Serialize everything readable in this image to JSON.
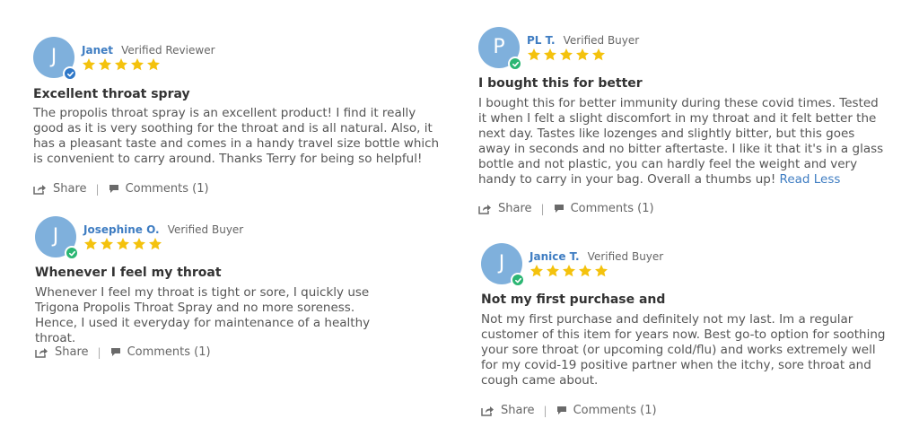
{
  "colors": {
    "avatar": "#7fb0dc",
    "name": "#3f7dc2",
    "star": "#f4c20d",
    "badge_blue": "#2f78c8",
    "badge_green": "#2bb673"
  },
  "icons": {
    "share": "share-arrow-icon",
    "comments": "comment-bubble-icon",
    "star": "star-icon",
    "verified": "check-badge-icon"
  },
  "reviews": [
    {
      "initial": "J",
      "name": "Janet",
      "status": "Verified Reviewer",
      "rating": 5,
      "title": "Excellent throat spray",
      "body": "The propolis throat spray is an excellent product! I find it really good as it is very soothing for the throat and is all natural. Also, it has a pleasant taste and comes in a handy travel size bottle which is convenient to carry around. Thanks Terry for being so helpful!",
      "share": "Share",
      "comments": "Comments (1)"
    },
    {
      "initial": "J",
      "name": "Josephine O.",
      "status": "Verified Buyer",
      "rating": 5,
      "title": "Whenever I feel my throat",
      "body_lines": [
        "Whenever I feel my throat is tight or sore, I quickly use Trigona Propolis Throat Spray and no more soreness.",
        "Hence, I used it everyday for maintenance of a healthy throat."
      ],
      "share": "Share",
      "comments": "Comments (1)"
    },
    {
      "initial": "P",
      "name": "PL T.",
      "status": "Verified Buyer",
      "rating": 5,
      "title": "I bought this for better",
      "body": "I bought this for better immunity during these covid times. Tested it when I felt a slight discomfort in my throat and it felt better the next day. Tastes like lozenges and slightly bitter, but this goes away in seconds and no bitter aftertaste. I like it that it's in a glass bottle and not plastic, you can hardly feel the weight and very handy to carry in your bag. Overall a thumbs up!",
      "read_less": "Read Less",
      "share": "Share",
      "comments": "Comments (1)"
    },
    {
      "initial": "J",
      "name": "Janice T.",
      "status": "Verified Buyer",
      "rating": 5,
      "title": "Not my first purchase and",
      "body": "Not my first purchase and definitely not my last. Im a regular customer of this item for years now. Best go-to option for soothing your sore throat (or upcoming cold/flu) and works extremely well for my covid-19 positive partner when the itchy, sore throat and cough came about.",
      "share": "Share",
      "comments": "Comments (1)"
    }
  ]
}
